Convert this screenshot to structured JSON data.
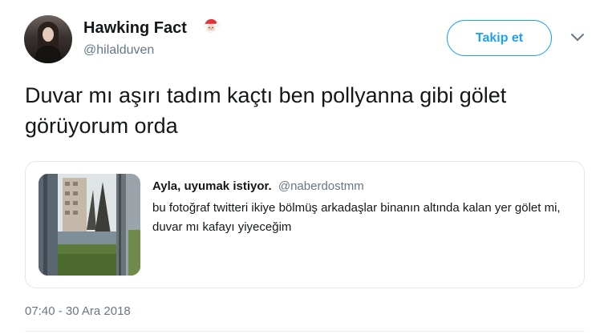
{
  "author": {
    "display_name": "Hawking Fact",
    "name_emoji_icon": "santa-face-icon",
    "handle": "@hilalduven"
  },
  "actions": {
    "follow_label": "Takip et",
    "more_icon": "chevron-down-icon"
  },
  "tweet": {
    "text": "Duvar mı aşırı tadım kaçtı ben pollyanna gibi gölet görüyorum orda",
    "timestamp": "07:40 - 30 Ara 2018"
  },
  "quoted_tweet": {
    "display_name": "Ayla, uyumak istiyor.",
    "handle": "@naberdostmm",
    "text": "bu fotoğraf twitteri ikiye bölmüş arkadaşlar binanın altında kalan yer gölet mi, duvar mı kafayı yiyeceğim"
  },
  "colors": {
    "accent": "#1da1f2",
    "secondary_text": "#657786",
    "primary_text": "#14171a",
    "border": "#e1e8ed"
  }
}
